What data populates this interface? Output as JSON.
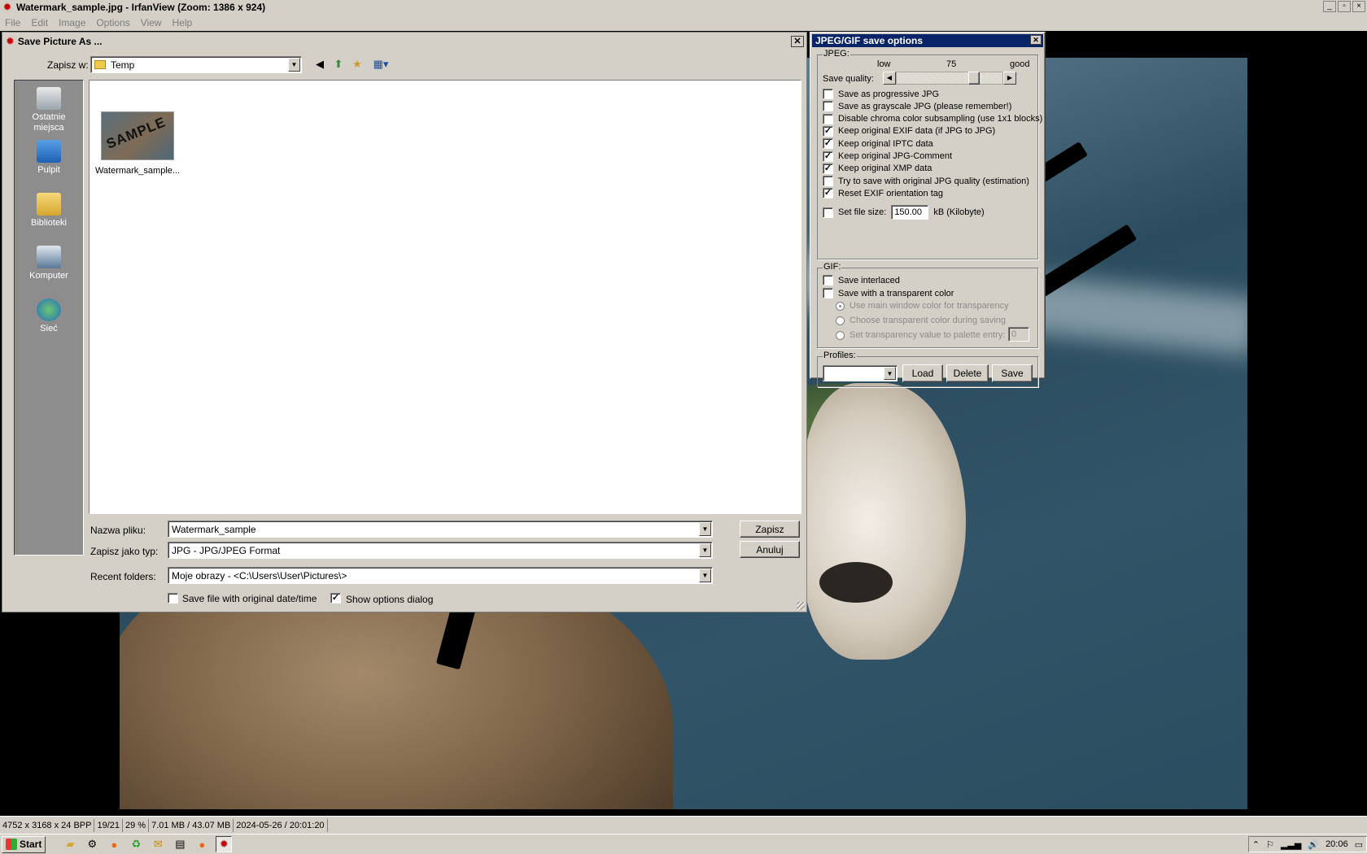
{
  "app": {
    "title": "Watermark_sample.jpg - IrfanView (Zoom: 1386 x 924)",
    "menu": [
      "File",
      "Edit",
      "Image",
      "Options",
      "View",
      "Help"
    ],
    "window_controls": [
      "_",
      "▫",
      "×"
    ]
  },
  "save_dialog": {
    "title": "Save Picture As ...",
    "save_in_label": "Zapisz w:",
    "save_in_value": "Temp",
    "places": [
      "Ostatnie\nmiejsca",
      "Pulpit",
      "Biblioteki",
      "Komputer",
      "Sieć"
    ],
    "file_item": {
      "name": "Watermark_sample...",
      "thumb_text": "SAMPLE"
    },
    "filename_label": "Nazwa pliku:",
    "filename_value": "Watermark_sample",
    "filetype_label": "Zapisz jako typ:",
    "filetype_value": "JPG - JPG/JPEG Format",
    "recent_label": "Recent folders:",
    "recent_value": "Moje obrazy  -  <C:\\Users\\User\\Pictures\\>",
    "save_button": "Zapisz",
    "cancel_button": "Anuluj",
    "keep_date_label": "Save file with original date/time",
    "keep_date_checked": false,
    "show_options_label": "Show options dialog",
    "show_options_checked": true
  },
  "options_dialog": {
    "title": "JPEG/GIF save options",
    "jpeg_group": "JPEG:",
    "quality_low": "low",
    "quality_value": "75",
    "quality_good": "good",
    "quality_label": "Save quality:",
    "quality_fraction": 0.75,
    "jpeg_options": [
      {
        "label": "Save as progressive JPG",
        "checked": false
      },
      {
        "label": "Save as grayscale JPG (please remember!)",
        "checked": false
      },
      {
        "label": "Disable chroma color subsampling (use 1x1 blocks)",
        "checked": false
      },
      {
        "label": "Keep original EXIF data (if JPG to JPG)",
        "checked": true
      },
      {
        "label": "Keep original IPTC data",
        "checked": true
      },
      {
        "label": "Keep original JPG-Comment",
        "checked": true
      },
      {
        "label": "Keep original XMP data",
        "checked": true
      },
      {
        "label": "Try to save with original JPG quality (estimation)",
        "checked": false
      },
      {
        "label": "Reset EXIF orientation tag",
        "checked": true
      }
    ],
    "filesize_label": "Set file size:",
    "filesize_value": "150.00",
    "filesize_unit": "kB (Kilobyte)",
    "gif_group": "GIF:",
    "gif_interlaced": "Save interlaced",
    "gif_transparent": "Save with a transparent color",
    "gif_radio": [
      {
        "label": "Use main window color for transparency",
        "selected": true
      },
      {
        "label": "Choose transparent color during saving",
        "selected": false
      },
      {
        "label": "Set transparency value to palette entry:",
        "selected": false
      }
    ],
    "palette_value": "0",
    "profiles_group": "Profiles:",
    "load_button": "Load",
    "delete_button": "Delete",
    "save_button": "Save"
  },
  "status": [
    "4752 x 3168 x 24 BPP",
    "19/21",
    "29 %",
    "7.01 MB / 43.07 MB",
    "2024-05-26 / 20:01:20"
  ],
  "taskbar": {
    "start": "Start",
    "clock": "20:06"
  }
}
